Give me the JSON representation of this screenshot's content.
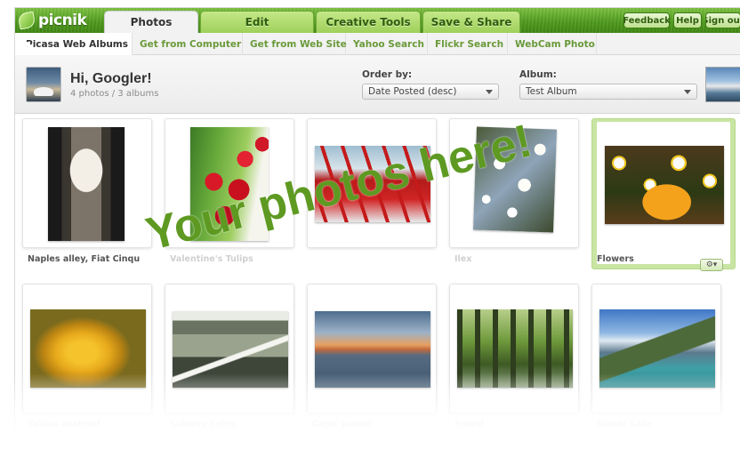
{
  "app": {
    "logo": "picnik"
  },
  "tabs": [
    {
      "label": "Photos",
      "active": true
    },
    {
      "label": "Edit",
      "active": false
    },
    {
      "label": "Creative Tools",
      "active": false
    },
    {
      "label": "Save & Share",
      "active": false
    }
  ],
  "top_buttons": {
    "feedback": "Feedback",
    "help": "Help",
    "signout": "Sign out"
  },
  "subtabs": [
    {
      "label": "Picasa Web Albums",
      "active": true
    },
    {
      "label": "Get from Computer"
    },
    {
      "label": "Get from Web Site"
    },
    {
      "label": "Yahoo Search"
    },
    {
      "label": "Flickr Search"
    },
    {
      "label": "WebCam Photo"
    }
  ],
  "header": {
    "greeting": "Hi, Googler!",
    "counts": "4 photos / 3 albums",
    "order_label": "Order by:",
    "order_value": "Date Posted (desc)",
    "album_label": "Album:",
    "album_value": "Test Album"
  },
  "photos": [
    {
      "caption": "Naples alley, Fiat Cinqu",
      "subject": "alley"
    },
    {
      "caption": "Valentine's Tulips",
      "subject": "tulips"
    },
    {
      "caption": "",
      "subject": "red chairs"
    },
    {
      "caption": "Ilex",
      "subject": "blossoms"
    },
    {
      "caption": "Flowers",
      "subject": "daisies",
      "selected": true
    },
    {
      "caption": "Yellow abstract",
      "subject": "yellow flower"
    },
    {
      "caption": "Subway lights",
      "subject": "subway"
    },
    {
      "caption": "Capri sunset",
      "subject": "sunset"
    },
    {
      "caption": "Forest",
      "subject": "forest"
    },
    {
      "caption": "Diablo Lake",
      "subject": "lake"
    }
  ],
  "overlay_text": "Your photos here!",
  "colors": {
    "brand_green": "#4f9a1e",
    "selected": "#c9e5a3",
    "overlay": "#5e9a22"
  }
}
